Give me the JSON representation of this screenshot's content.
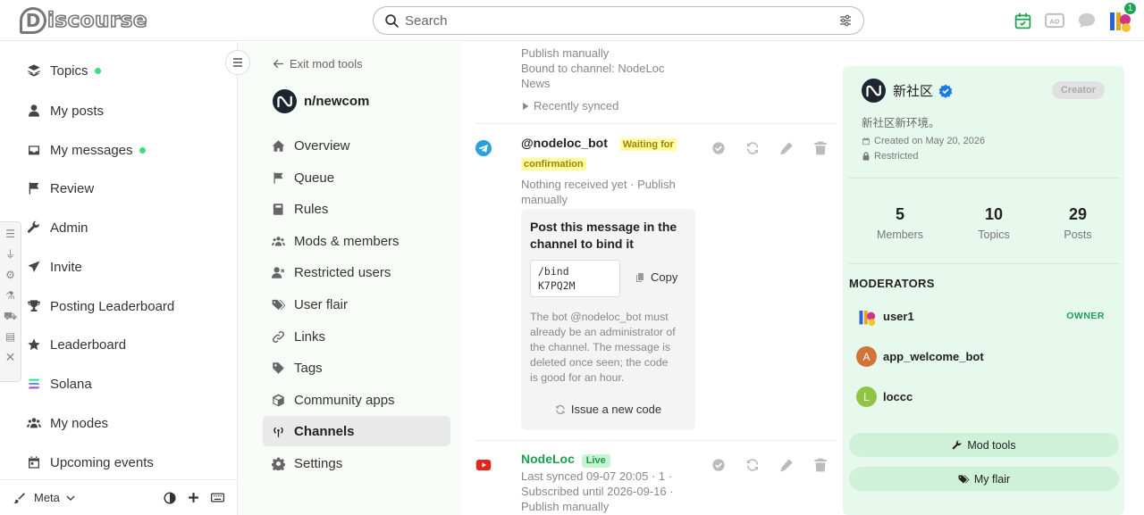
{
  "header": {
    "logo_mark": "D",
    "logo_text": "iscourse",
    "search_placeholder": "Search",
    "notification_count": "1",
    "icons": [
      "calendar-icon",
      "ad-icon",
      "chat-icon",
      "avatar"
    ]
  },
  "sidebar": {
    "items": [
      {
        "label": "Topics",
        "icon": "layers-icon",
        "dot": true
      },
      {
        "label": "My posts",
        "icon": "user-icon",
        "dot": false
      },
      {
        "label": "My messages",
        "icon": "inbox-icon",
        "dot": true
      },
      {
        "label": "Review",
        "icon": "flag-icon",
        "dot": false
      },
      {
        "label": "Admin",
        "icon": "wrench-icon",
        "dot": false
      },
      {
        "label": "Invite",
        "icon": "paper-plane-icon",
        "dot": false
      },
      {
        "label": "Posting Leaderboard",
        "icon": "trophy-icon",
        "dot": false
      },
      {
        "label": "Leaderboard",
        "icon": "star-icon",
        "dot": false
      },
      {
        "label": "Solana",
        "icon": "solana-icon",
        "dot": false
      },
      {
        "label": "My nodes",
        "icon": "users-icon",
        "dot": false
      },
      {
        "label": "Upcoming events",
        "icon": "calendar-icon",
        "dot": false
      }
    ],
    "footer_label": "Meta"
  },
  "modnav": {
    "exit_label": "Exit mod tools",
    "community_name": "n/newcom",
    "items": [
      {
        "label": "Overview",
        "icon": "home-icon"
      },
      {
        "label": "Queue",
        "icon": "flag-icon"
      },
      {
        "label": "Rules",
        "icon": "book-icon"
      },
      {
        "label": "Mods & members",
        "icon": "users-icon"
      },
      {
        "label": "Restricted users",
        "icon": "user-x-icon"
      },
      {
        "label": "User flair",
        "icon": "tag-icon"
      },
      {
        "label": "Links",
        "icon": "link-icon"
      },
      {
        "label": "Tags",
        "icon": "tag-icon"
      },
      {
        "label": "Community apps",
        "icon": "cube-icon"
      },
      {
        "label": "Channels",
        "icon": "broadcast-icon",
        "active": true
      },
      {
        "label": "Settings",
        "icon": "gear-icon"
      }
    ]
  },
  "channels": {
    "top_partial": {
      "line1": "Publish manually",
      "line2": "Bound to channel: NodeLoc",
      "line3": "News",
      "recently_synced": "Recently synced"
    },
    "bot": {
      "name": "@nodeloc_bot",
      "badge_line1": "Waiting for",
      "badge_line2": "confirmation",
      "status_line1": "Nothing received yet · Publish",
      "status_line2": "manually",
      "bind_title_line1": "Post this message in the",
      "bind_title_line2": "channel to bind it",
      "code_line1": "/bind",
      "code_line2": "K7PQ2M",
      "copy_label": "Copy",
      "note_lines": [
        "The bot @nodeloc_bot must",
        "already be an administrator of",
        "the channel. The message is",
        "deleted once seen; the code",
        "is good for an hour."
      ],
      "issue_label": "Issue a new code"
    },
    "youtube": {
      "name": "NodeLoc",
      "badge": "Live",
      "line1": "Last synced 09-07 20:05 · 1 ·",
      "line2": "Subscribed until 2026-09-16 ·",
      "line3": "Publish manually"
    }
  },
  "community": {
    "name": "新社区",
    "creator_label": "Creator",
    "description": "新社区新环境。",
    "created": "Created on May 20, 2026",
    "restricted": "Restricted",
    "stats": [
      {
        "num": "5",
        "label": "Members"
      },
      {
        "num": "10",
        "label": "Topics"
      },
      {
        "num": "29",
        "label": "Posts"
      }
    ],
    "moderators_title": "MODERATORS",
    "moderators": [
      {
        "name": "user1",
        "initial": "",
        "color": "#ffffff",
        "owner": true
      },
      {
        "name": "app_welcome_bot",
        "initial": "A",
        "color": "#d2733a",
        "owner": false
      },
      {
        "name": "loccc",
        "initial": "L",
        "color": "#8fc445",
        "owner": false
      }
    ],
    "owner_label": "OWNER",
    "mod_tools_label": "Mod tools",
    "my_flair_label": "My flair"
  },
  "colors": {
    "accent_green": "#1ca551",
    "panel_bg": "#e7f9ed",
    "telegram": "#2aa1de",
    "youtube": "#e1271b",
    "verified": "#1a7be8"
  }
}
